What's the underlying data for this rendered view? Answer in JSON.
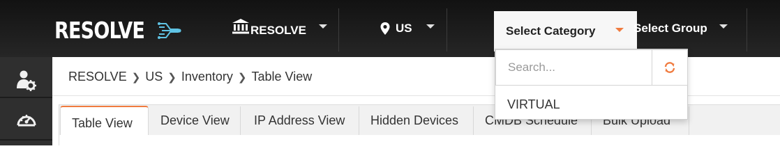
{
  "logo": {
    "text": "RESOLVE"
  },
  "header": {
    "org": {
      "label": "RESOLVE",
      "icon": "bank-icon"
    },
    "location": {
      "label": "US",
      "icon": "map-pin-icon"
    },
    "category": {
      "label": "Select Category"
    },
    "group": {
      "label": "Select Group"
    }
  },
  "sidebar": {
    "items": [
      {
        "icon": "user-settings-icon"
      },
      {
        "icon": "dashboard-gauge-icon"
      }
    ]
  },
  "breadcrumb": [
    "RESOLVE",
    "US",
    "Inventory",
    "Table View"
  ],
  "tabs": [
    "Table View",
    "Device View",
    "IP Address View",
    "Hidden Devices",
    "CMDB Schedule",
    "Bulk Upload"
  ],
  "dropdown": {
    "search_placeholder": "Search...",
    "options": [
      "VIRTUAL"
    ],
    "refresh_icon": "refresh-icon"
  },
  "colors": {
    "accent": "#f07b3f",
    "header_bg": "#1a1a1a",
    "sidebar_bg": "#2f2f2f",
    "logo_circuit": "#5fc3e4"
  }
}
